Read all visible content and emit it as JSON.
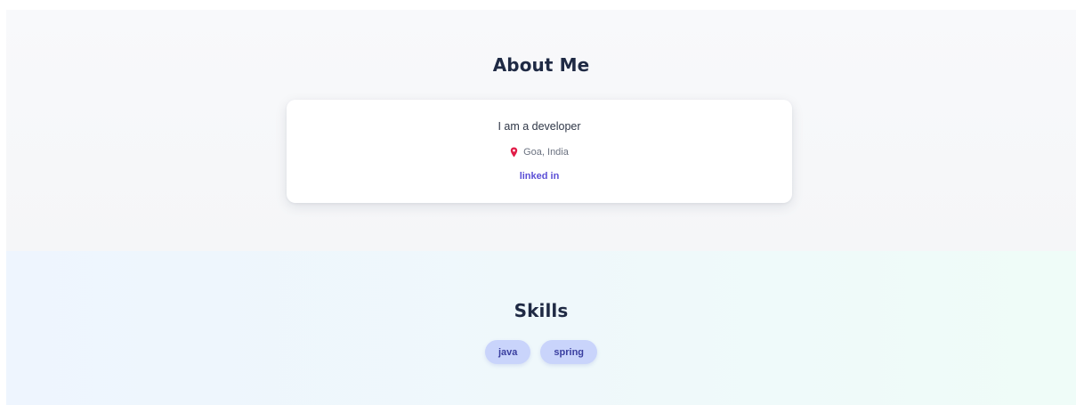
{
  "about": {
    "title": "About Me",
    "bio": "I am a developer",
    "location": "Goa, India",
    "location_icon": "map-pin-icon",
    "link_label": "linked in"
  },
  "skills": {
    "title": "Skills",
    "items": [
      {
        "label": "java"
      },
      {
        "label": "spring"
      }
    ]
  },
  "colors": {
    "accent": "#5b4fd6",
    "pin": "#e11d48",
    "chip_bg": "#c9d4fb",
    "chip_text": "#3a3fa0",
    "heading": "#1f2a44"
  }
}
